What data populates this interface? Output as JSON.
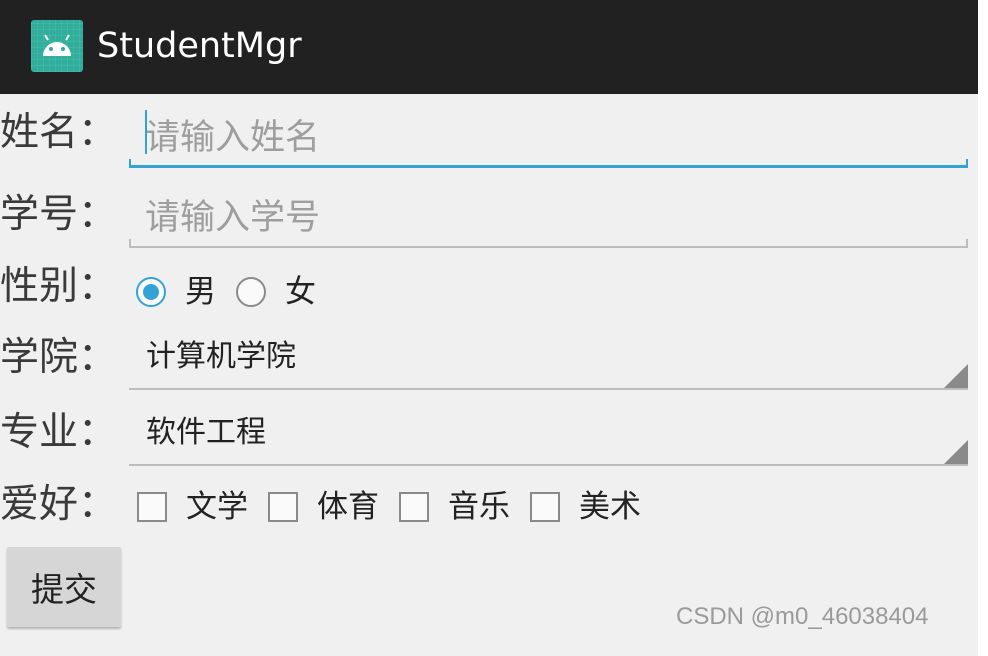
{
  "app": {
    "title": "StudentMgr",
    "brand_color": "#2fae9b",
    "actionbar_color": "#212121",
    "accent_color": "#33a3d6"
  },
  "form": {
    "name": {
      "label": "姓名：",
      "value": "",
      "placeholder": "请输入姓名"
    },
    "student_id": {
      "label": "学号：",
      "value": "",
      "placeholder": "请输入学号"
    },
    "gender": {
      "label": "性别：",
      "options": [
        {
          "label": "男",
          "checked": true
        },
        {
          "label": "女",
          "checked": false
        }
      ]
    },
    "college": {
      "label": "学院：",
      "selected": "计算机学院"
    },
    "major": {
      "label": "专业：",
      "selected": "软件工程"
    },
    "hobbies": {
      "label": "爱好：",
      "options": [
        {
          "label": "文学",
          "checked": false
        },
        {
          "label": "体育",
          "checked": false
        },
        {
          "label": "音乐",
          "checked": false
        },
        {
          "label": "美术",
          "checked": false
        }
      ]
    },
    "submit_label": "提交"
  },
  "watermark": "CSDN @m0_46038404"
}
